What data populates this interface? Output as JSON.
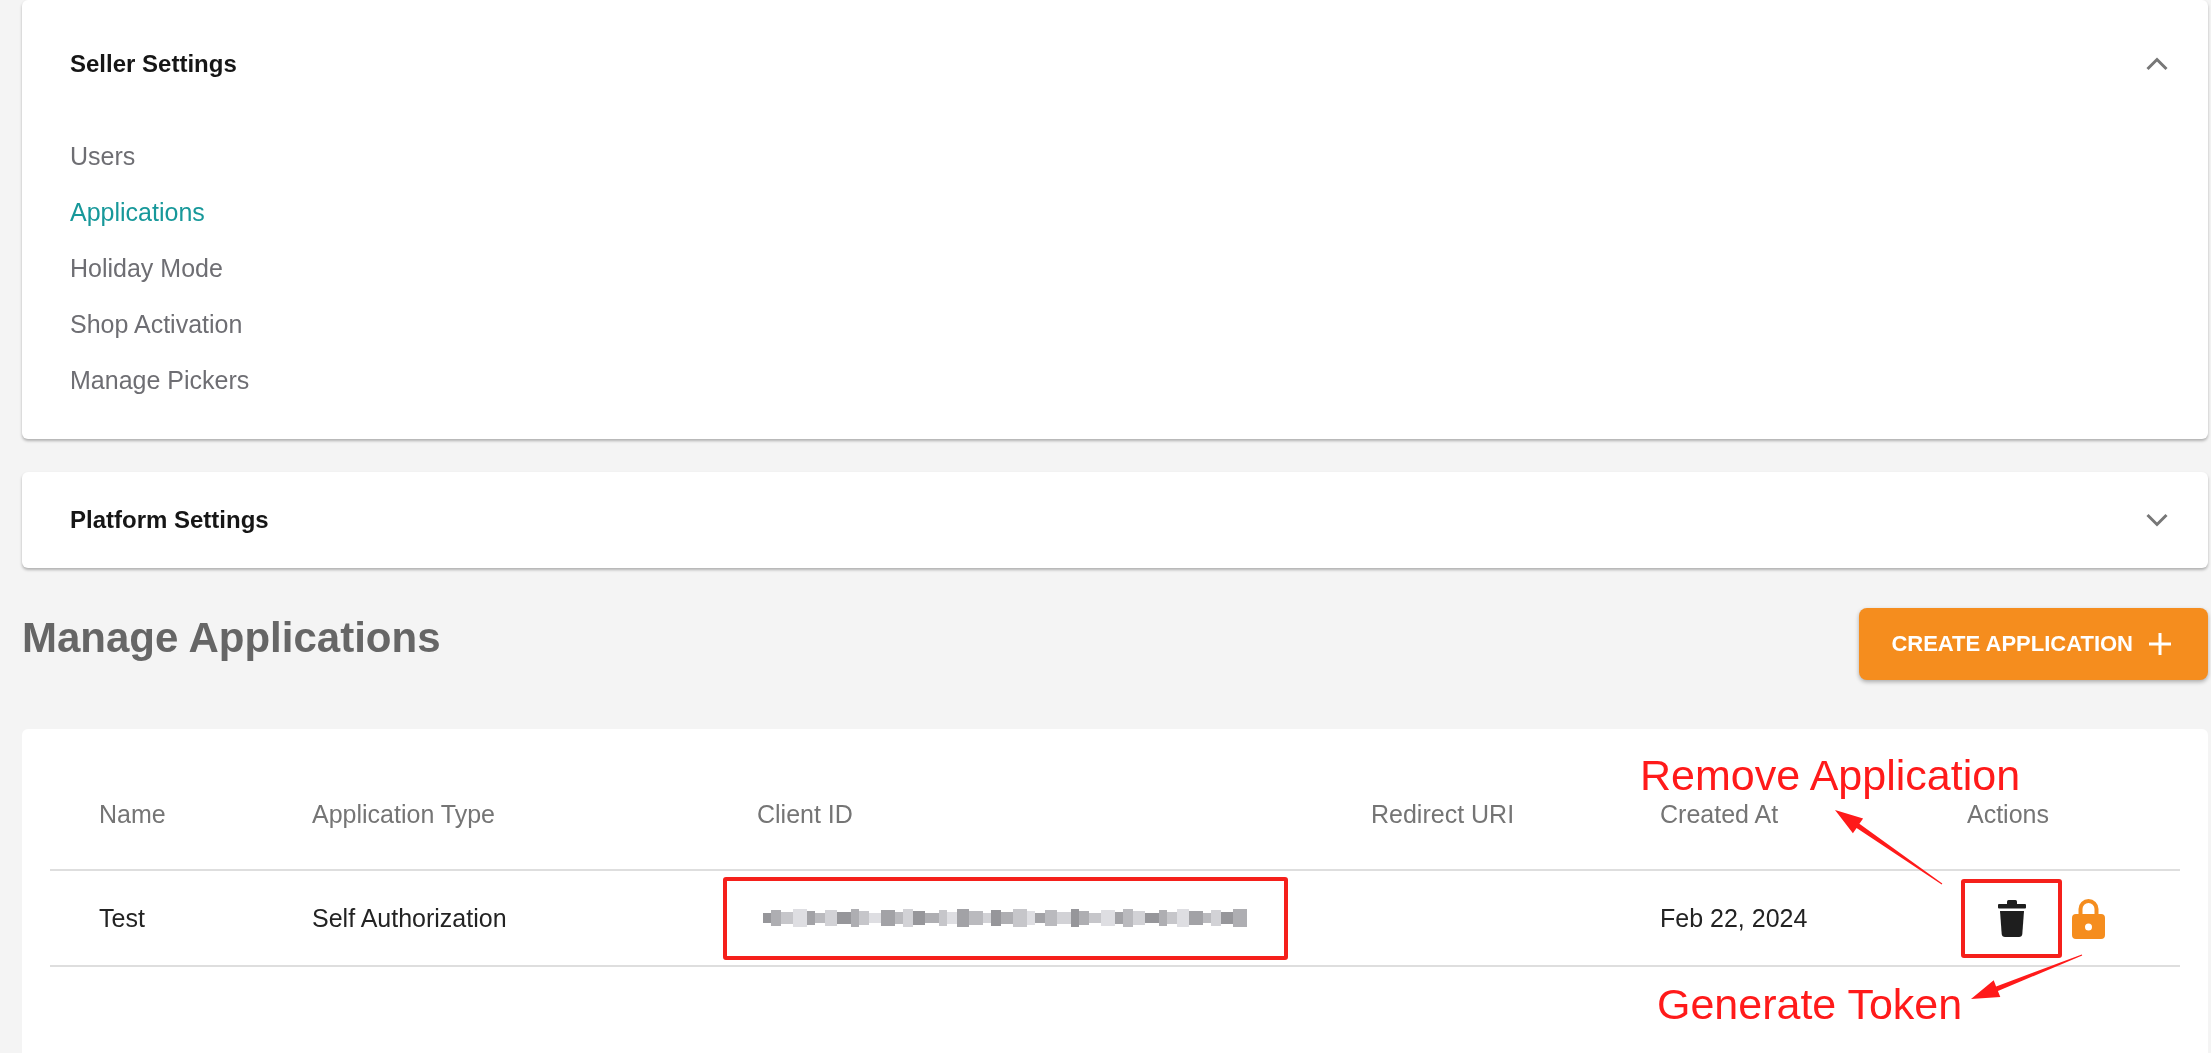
{
  "settings_panels": [
    {
      "title": "Seller Settings",
      "expanded": true,
      "items": [
        {
          "label": "Users",
          "selected": false
        },
        {
          "label": "Applications",
          "selected": true
        },
        {
          "label": "Holiday Mode",
          "selected": false
        },
        {
          "label": "Shop Activation",
          "selected": false
        },
        {
          "label": "Manage Pickers",
          "selected": false
        }
      ]
    },
    {
      "title": "Platform Settings",
      "expanded": false
    }
  ],
  "page_title": "Manage Applications",
  "create_button": {
    "label": "CREATE APPLICATION"
  },
  "table": {
    "columns": [
      "Name",
      "Application Type",
      "Client ID",
      "Redirect URI",
      "Created At",
      "Actions"
    ],
    "rows": [
      {
        "name": "Test",
        "application_type": "Self Authorization",
        "client_id": {
          "highlighted": true
        },
        "created_at": "Feb 22, 2024",
        "actions": [
          {
            "kind": "delete",
            "highlighted": true
          },
          {
            "kind": "token",
            "highlighted": false
          }
        ]
      }
    ]
  },
  "annotations": [
    {
      "text": "Remove Application"
    },
    {
      "text": "Generate Token"
    }
  ]
}
